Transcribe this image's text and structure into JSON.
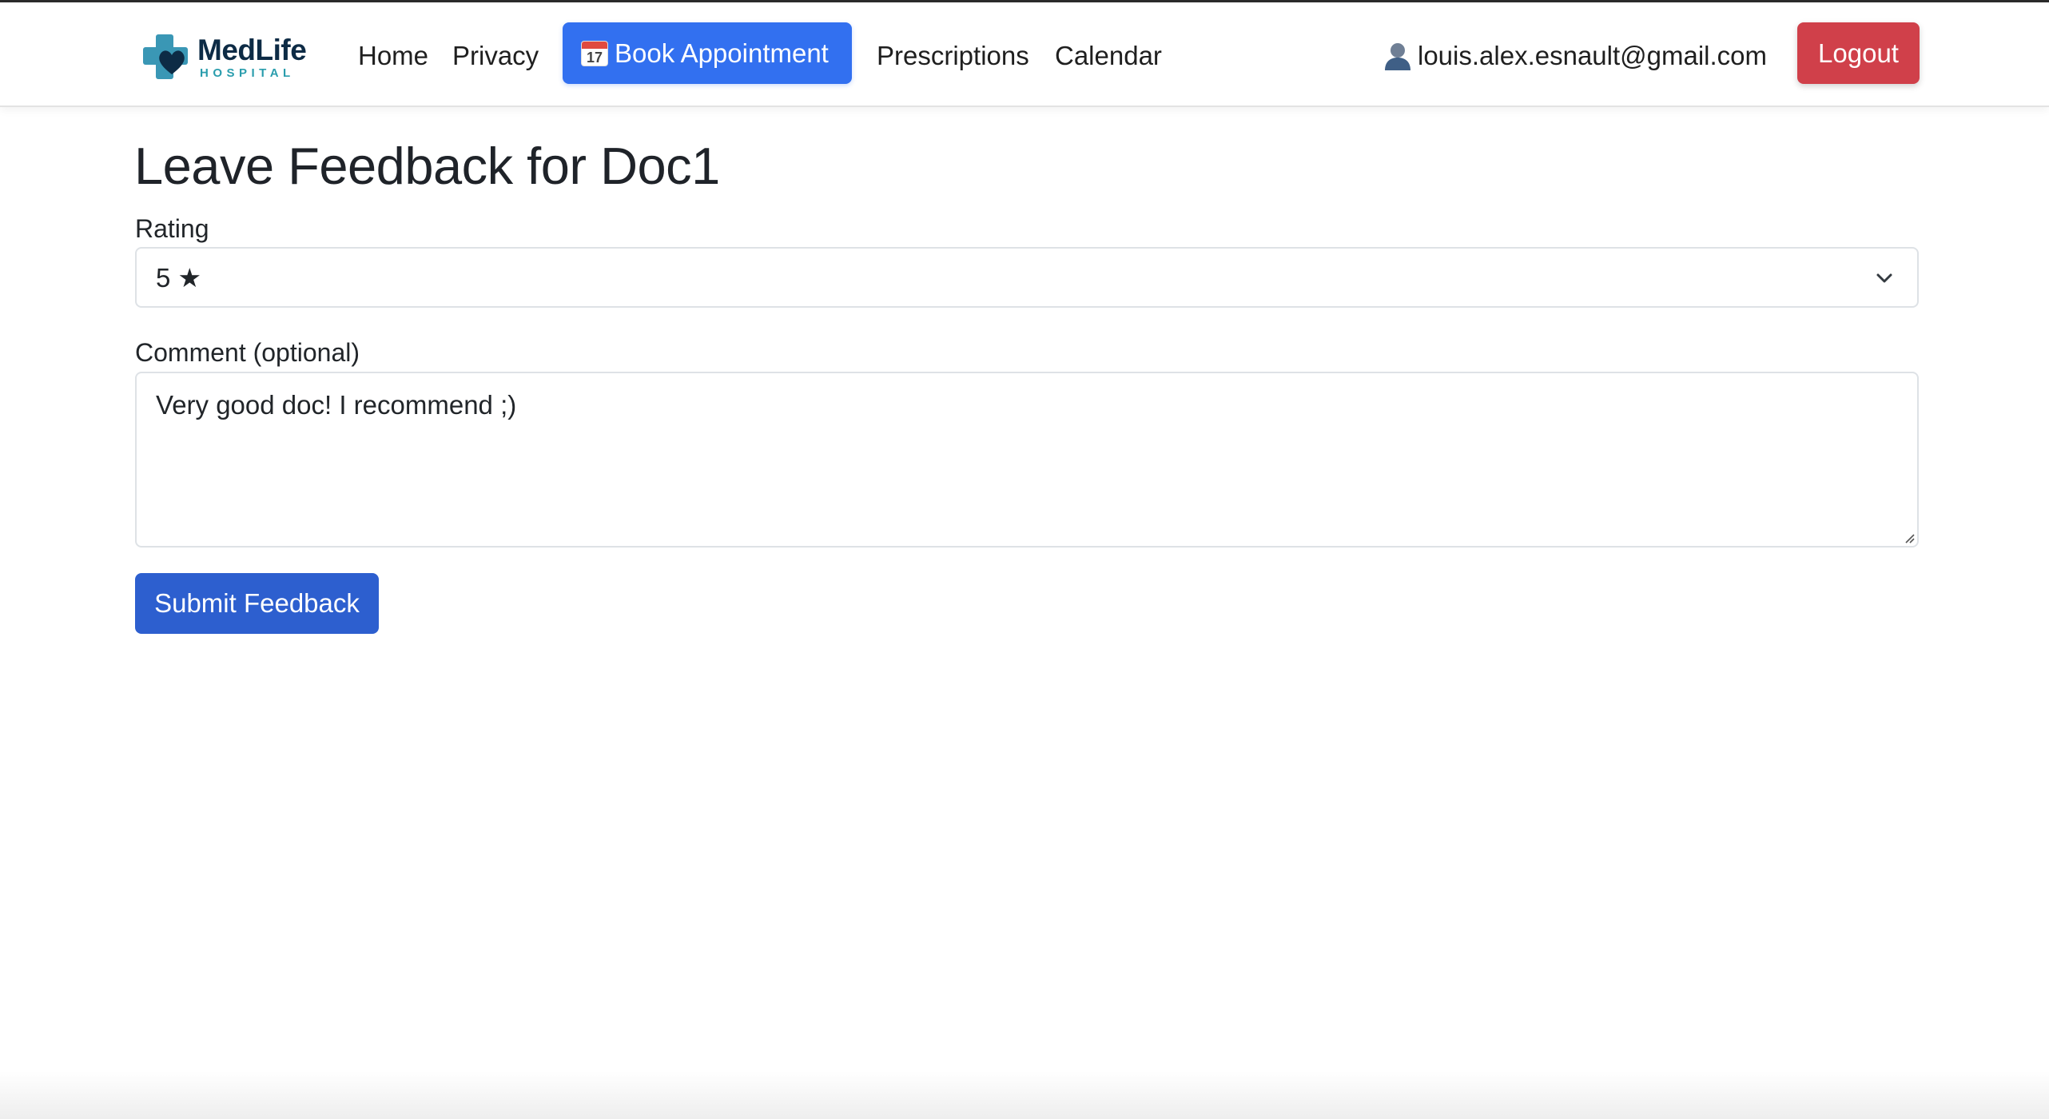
{
  "navbar": {
    "brand": {
      "name": "MedLife",
      "sub": "HOSPITAL"
    },
    "links": [
      {
        "label": "Home"
      },
      {
        "label": "Privacy"
      }
    ],
    "book_button": {
      "icon_text": "17",
      "label": "Book Appointment"
    },
    "links_right": [
      {
        "label": "Prescriptions"
      },
      {
        "label": "Calendar"
      }
    ],
    "user_email": "louis.alex.esnault@gmail.com",
    "logout_label": "Logout"
  },
  "page": {
    "title": "Leave Feedback for Doc1",
    "rating": {
      "label": "Rating",
      "selected": "5 ★"
    },
    "comment": {
      "label": "Comment (optional)",
      "value": "Very good doc! I recommend ;)"
    },
    "submit_label": "Submit Feedback"
  },
  "colors": {
    "primary": "#3270f0",
    "submit": "#2d5fcf",
    "danger": "#d0404a",
    "brand_navy": "#0d2b45",
    "brand_teal": "#2a9dad"
  }
}
